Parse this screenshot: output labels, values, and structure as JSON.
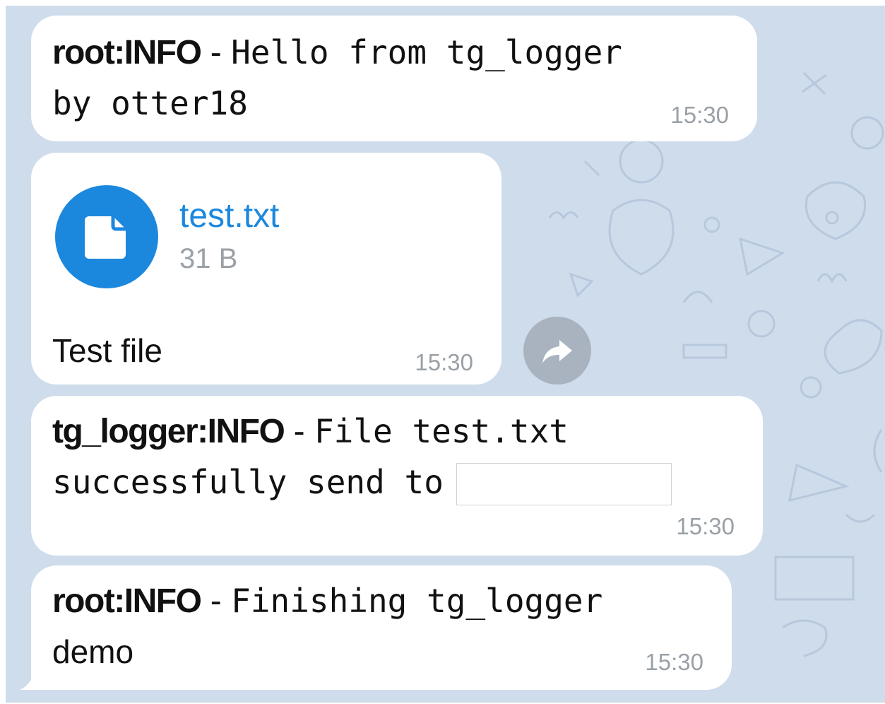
{
  "messages": [
    {
      "level": "root:INFO",
      "separator": " - ",
      "line1": "Hello from tg_logger",
      "line2": "by otter18",
      "time": "15:30"
    },
    {
      "file_name": "test.txt",
      "file_size": "31 B",
      "caption": "Test file",
      "time": "15:30",
      "file_icon": "document-icon"
    },
    {
      "level": "tg_logger:INFO",
      "separator": " - ",
      "line1": "File test.txt",
      "line2": "successfully send to",
      "time": "15:30"
    },
    {
      "level": "root:INFO",
      "separator": " - ",
      "line1": "Finishing tg_logger",
      "line2": "demo",
      "time": "15:30"
    }
  ],
  "share_icon": "share-arrow-icon",
  "colors": {
    "chat_background": "#cfdcec",
    "bubble": "#ffffff",
    "accent": "#1b88de",
    "timestamp": "#9aa0a6"
  }
}
